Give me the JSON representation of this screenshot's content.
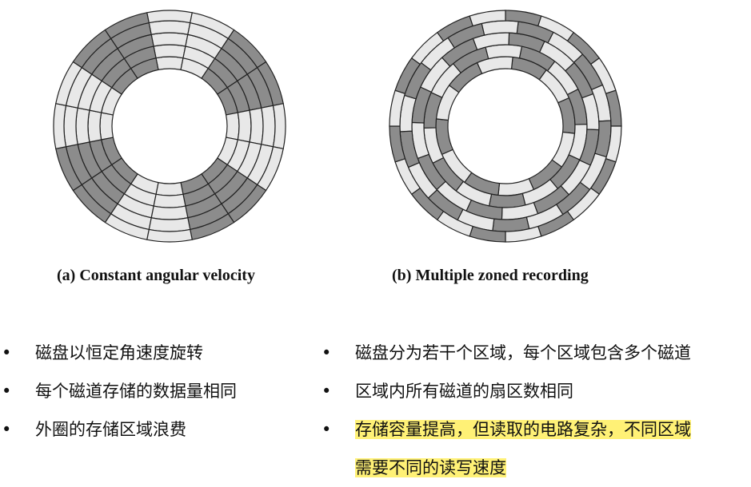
{
  "figures": [
    {
      "caption": "(a) Constant angular velocity"
    },
    {
      "caption": "(b) Multiple zoned recording"
    }
  ],
  "colors": {
    "dark": "#8c8c8c",
    "light": "#e8e8e8",
    "stroke": "#222222",
    "highlight": "#fff176"
  },
  "bullets_left": [
    {
      "bullet": "•",
      "text": "磁盘以恒定角速度旋转"
    },
    {
      "bullet": "•",
      "text": "每个磁道存储的数据量相同"
    },
    {
      "bullet": "•",
      "text": "外圈的存储区域浪费"
    }
  ],
  "bullets_right": [
    {
      "bullet": "•",
      "text": "磁盘分为若干个区域，每个区域包含多个磁道"
    },
    {
      "bullet": "•",
      "text": "区域内所有磁道的扇区数相同"
    },
    {
      "bullet": "•",
      "line1": "存储容量提高，但读取的电路复杂，不同区域",
      "line2": "需要不同的读写速度"
    }
  ]
}
